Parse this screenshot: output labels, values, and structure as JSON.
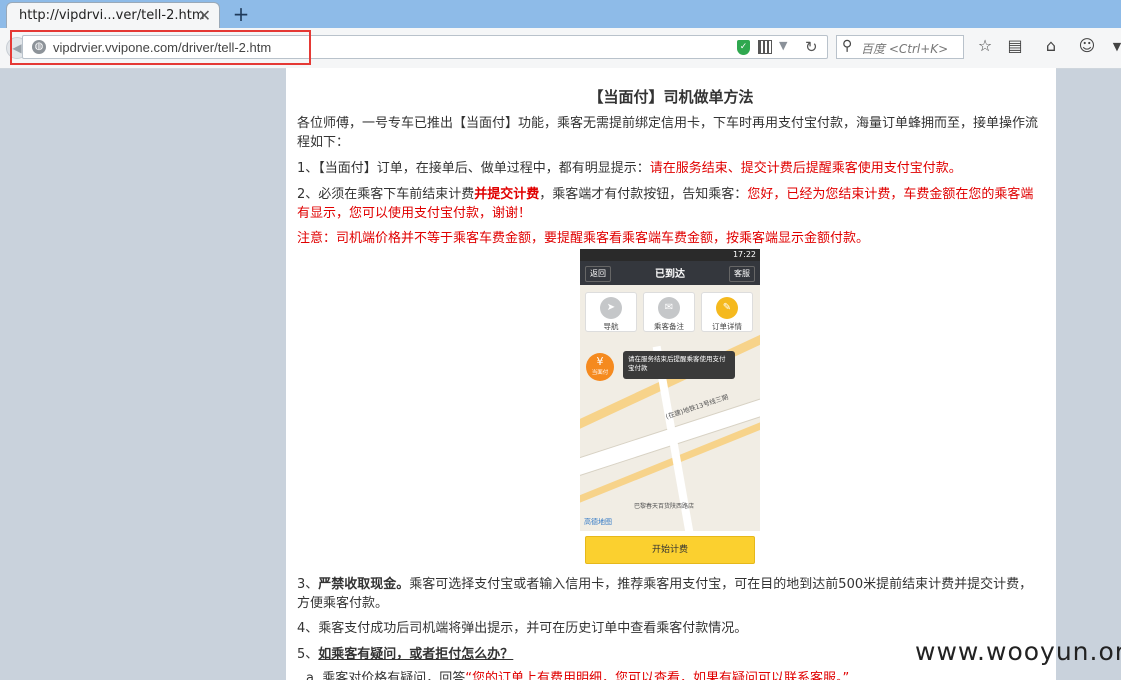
{
  "browser": {
    "tab_title": "http://vipdrvi...ver/tell-2.htm",
    "tab_close": "✕",
    "new_tab": "+",
    "url": "vipdrvier.vvipone.com/driver/tell-2.htm",
    "search_placeholder": "百度 <Ctrl+K>"
  },
  "page": {
    "title": "【当面付】司机做单方法",
    "intro": "各位师傅，一号专车已推出【当面付】功能，乘客无需提前绑定信用卡，下车时再用支付宝付款，海量订单蜂拥而至，接单操作流程如下：",
    "step1_prefix": "1、【当面付】订单，在接单后、做单过程中，都有明显提示：",
    "step1_red": "请在服务结束、提交计费后提醒乘客使用支付宝付款。",
    "step2_prefix": "2、必须在乘客下车前结束计费",
    "step2_bold": "并提交计费",
    "step2_mid": "，乘客端才有付款按钮，告知乘客：",
    "step2_red": "您好，已经为您结束计费，车费金额在您的乘客端有显示，您可以使用支付宝付款，谢谢！",
    "note": "注意：司机端价格并不等于乘客车费金额，要提醒乘客看乘客端车费金额，按乘客端显示金额付款。",
    "step3_prefix": "3、",
    "step3_bold": "严禁收取现金。",
    "step3_rest": "乘客可选择支付宝或者输入信用卡，推荐乘客用支付宝，可在目的地到达前500米提前结束计费并提交计费，方便乘客付款。",
    "step4": "4、乘客支付成功后司机端将弹出提示，并可在历史订单中查看乘客付款情况。",
    "step5_prefix": "5、",
    "step5_link": "如乘客有疑问，或者拒付怎么办？",
    "step5_sub_prefix": "a. 乘客对价格有疑问，回答",
    "step5_sub_red": "“您的订单上有费用明细，您可以查看，如果有疑问可以联系客服。”"
  },
  "phone": {
    "time": "17:22",
    "back": "返回",
    "title": "已到达",
    "service": "客服",
    "cards": [
      {
        "label": "导航",
        "icon": "navigation-icon"
      },
      {
        "label": "乘客备注",
        "icon": "chat-icon"
      },
      {
        "label": "订单详情",
        "icon": "edit-icon"
      }
    ],
    "pay_symbol": "¥",
    "pay_label": "当面付",
    "tip": "请在服务结束后提醒乘客使用支付宝付款",
    "road_label": "(在建)地铁13号线三期",
    "poi": "巴黎春天百货陕西路店",
    "map_logo": "高德地图",
    "start_button": "开始计费"
  },
  "watermark": "www.wooyun.org",
  "colors": {
    "highlight": "#e53935",
    "red_text": "#e00000",
    "start_button": "#fbd02f"
  }
}
